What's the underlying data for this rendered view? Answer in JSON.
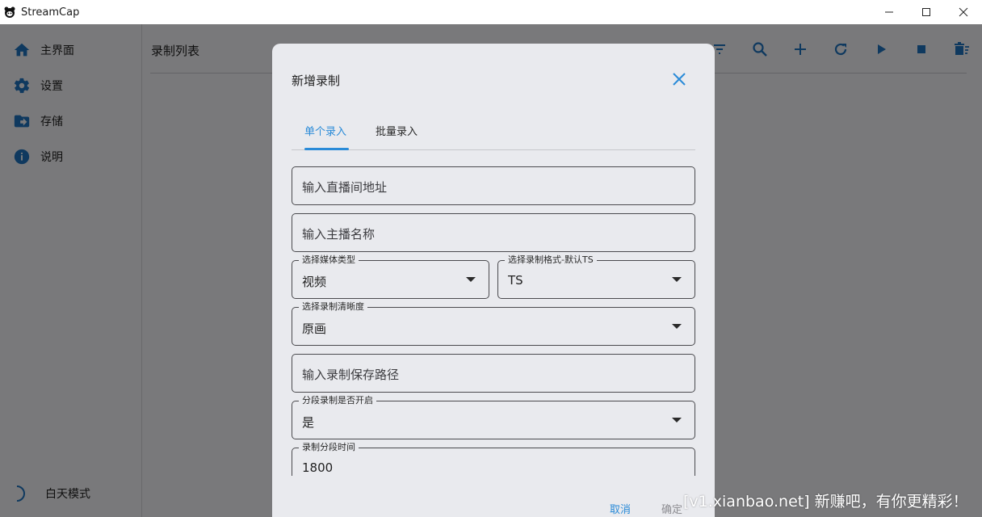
{
  "window": {
    "title": "StreamCap",
    "controls": [
      "minimize-icon",
      "maximize-icon",
      "close-icon"
    ]
  },
  "sidebar": {
    "items": [
      {
        "label": "主界面",
        "icon": "home-icon"
      },
      {
        "label": "设置",
        "icon": "gear-icon"
      },
      {
        "label": "存储",
        "icon": "folder-icon"
      },
      {
        "label": "说明",
        "icon": "info-icon"
      }
    ],
    "theme_toggle": {
      "label": "白天模式",
      "icon": "moon-icon"
    }
  },
  "main": {
    "title": "录制列表",
    "toolbar": [
      "filter-icon",
      "search-icon",
      "add-icon",
      "refresh-icon",
      "play-icon",
      "stop-icon",
      "delete-icon"
    ]
  },
  "dialog": {
    "title": "新增录制",
    "tabs": [
      {
        "label": "单个录入",
        "active": true
      },
      {
        "label": "批量录入",
        "active": false
      }
    ],
    "fields": {
      "stream_url": {
        "placeholder": "输入直播间地址"
      },
      "streamer_name": {
        "placeholder": "输入主播名称"
      },
      "media_type": {
        "label": "选择媒体类型",
        "value": "视频"
      },
      "record_format": {
        "label": "选择录制格式-默认TS",
        "value": "TS"
      },
      "record_quality": {
        "label": "选择录制清晰度",
        "value": "原画"
      },
      "save_path": {
        "placeholder": "输入录制保存路径"
      },
      "segment_enabled": {
        "label": "分段录制是否开启",
        "value": "是"
      },
      "segment_time": {
        "label": "录制分段时间",
        "value": "1800"
      }
    },
    "actions": {
      "cancel": "取消",
      "ok": "确定"
    }
  },
  "watermark": "[v1.xianbao.net] 新赚吧，有你更精彩！",
  "colors": {
    "accent": "#2a8bd8",
    "sidebar_icon": "#1e73be"
  }
}
